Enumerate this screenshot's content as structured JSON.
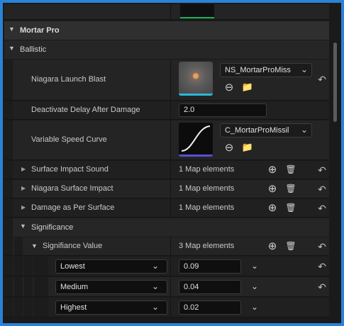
{
  "categories": {
    "mortar_pro": "Mortar Pro",
    "ballistic": "Ballistic",
    "significance": "Significance"
  },
  "properties": {
    "niagara_launch_blast": {
      "label": "Niagara Launch Blast",
      "asset": "NS_MortarProMiss"
    },
    "deactivate_delay": {
      "label": "Deactivate Delay After Damage",
      "value": "2.0"
    },
    "variable_speed_curve": {
      "label": "Variable Speed Curve",
      "asset": "C_MortarProMissil"
    },
    "surface_impact_sound": {
      "label": "Surface Impact Sound",
      "value": "1 Map elements"
    },
    "niagara_surface_impact": {
      "label": "Niagara Surface Impact",
      "value": "1 Map elements"
    },
    "damage_per_surface": {
      "label": "Damage as Per Surface",
      "value": "1 Map elements"
    },
    "significance_value": {
      "label": "Signifiance Value",
      "value": "3 Map elements"
    }
  },
  "map_entries": [
    {
      "key": "Lowest",
      "value": "0.09"
    },
    {
      "key": "Medium",
      "value": "0.04"
    },
    {
      "key": "Highest",
      "value": "0.02"
    }
  ],
  "icons": {
    "expand_open": "▼",
    "expand_closed": "▶",
    "dropdown": "⌄",
    "reset": "↶",
    "add": "⊕",
    "delete": "🗑",
    "browse": "⊖",
    "find": "📁"
  },
  "colors": {
    "frame_border": "#2a83d6",
    "thumbnail_accent": "#2ab7d9",
    "curve_accent": "#5a4fd8"
  }
}
